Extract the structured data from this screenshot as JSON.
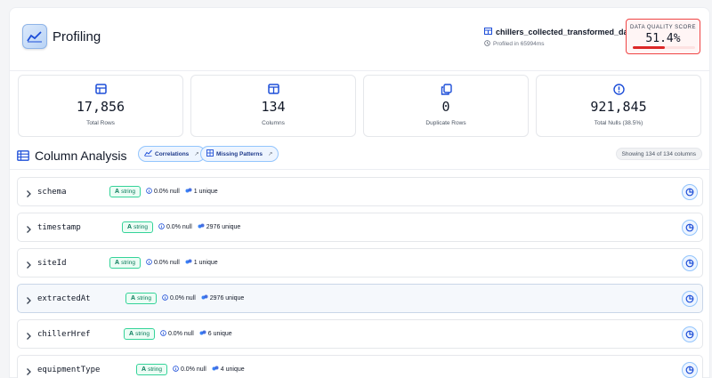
{
  "header": {
    "title": "Profiling",
    "dataset_name": "chillers_collected_transformed_data",
    "profiled_text": "Profiled in 65994ms",
    "quality_label": "DATA QUALITY SCORE",
    "quality_value": "51.4%",
    "quality_fraction": 0.514
  },
  "stats": [
    {
      "icon": "table-icon",
      "value": "17,856",
      "label": "Total Rows"
    },
    {
      "icon": "columns-icon",
      "value": "134",
      "label": "Columns"
    },
    {
      "icon": "copy-icon",
      "value": "0",
      "label": "Duplicate Rows"
    },
    {
      "icon": "alert-circle-icon",
      "value": "921,845",
      "label": "Total Nulls (38.5%)"
    }
  ],
  "analysis": {
    "title": "Column Analysis",
    "chip_correlations": "Correlations",
    "chip_missing": "Missing Patterns",
    "showing": "Showing 134 of 134 columns"
  },
  "columns": [
    {
      "name": "schema",
      "type_letter": "A",
      "type": "string",
      "null": "0.0% null",
      "unique": "1 unique"
    },
    {
      "name": "timestamp",
      "type_letter": "A",
      "type": "string",
      "null": "0.0% null",
      "unique": "2976 unique"
    },
    {
      "name": "siteId",
      "type_letter": "A",
      "type": "string",
      "null": "0.0% null",
      "unique": "1 unique"
    },
    {
      "name": "extractedAt",
      "type_letter": "A",
      "type": "string",
      "null": "0.0% null",
      "unique": "2976 unique"
    },
    {
      "name": "chillerHref",
      "type_letter": "A",
      "type": "string",
      "null": "0.0% null",
      "unique": "6 unique"
    },
    {
      "name": "equipmentType",
      "type_letter": "A",
      "type": "string",
      "null": "0.0% null",
      "unique": "4 unique"
    }
  ],
  "colors": {
    "accent": "#1d4ed8",
    "quality_alert": "#dc2626",
    "type_badge": "#047857"
  }
}
